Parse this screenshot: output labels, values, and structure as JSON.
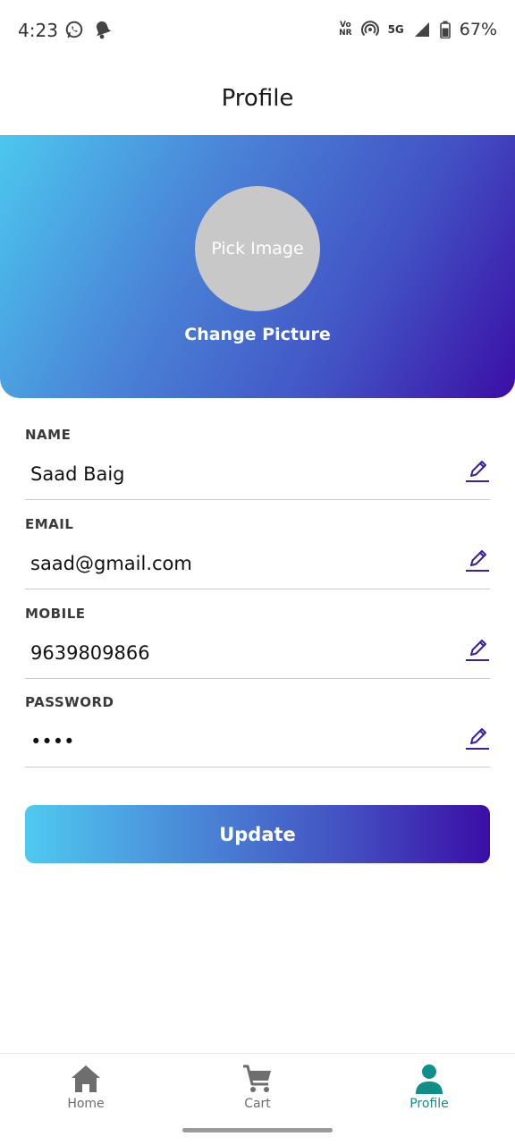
{
  "status_bar": {
    "time": "4:23",
    "volte_top": "Vo",
    "volte_bottom": "NR",
    "network": "5G",
    "battery": "67%"
  },
  "app_bar": {
    "title": "Profile"
  },
  "header": {
    "avatar_placeholder": "Pick Image",
    "change_picture": "Change Picture"
  },
  "form": {
    "name": {
      "label": "NAME",
      "value": "Saad Baig"
    },
    "email": {
      "label": "EMAIL",
      "value": "saad@gmail.com"
    },
    "mobile": {
      "label": "MOBILE",
      "value": "9639809866"
    },
    "password": {
      "label": "PASSWORD",
      "value": "••••"
    }
  },
  "update_button": "Update",
  "bottom_nav": {
    "home": "Home",
    "cart": "Cart",
    "profile": "Profile"
  },
  "colors": {
    "accent": "#3b0ea6",
    "active_nav": "#0f8f87",
    "edit_icon": "#3b1ea6"
  }
}
